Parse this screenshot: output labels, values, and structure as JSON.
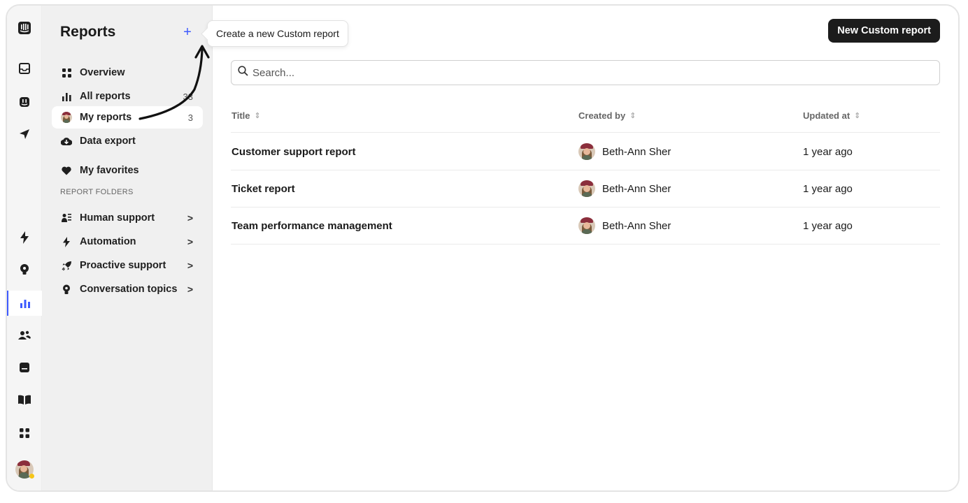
{
  "sidebar": {
    "title": "Reports",
    "add_icon": "plus-icon",
    "items": [
      {
        "label": "Overview",
        "icon": "grid-icon"
      },
      {
        "label": "All reports",
        "icon": "bar-chart-icon",
        "count": "33"
      },
      {
        "label": "My reports",
        "icon": "avatar-icon",
        "count": "3"
      },
      {
        "label": "Data export",
        "icon": "cloud-download-icon"
      },
      {
        "label": "My favorites",
        "icon": "heart-icon"
      }
    ],
    "section_label": "REPORT FOLDERS",
    "folders": [
      {
        "label": "Human support",
        "icon": "human-support-icon"
      },
      {
        "label": "Automation",
        "icon": "lightning-icon"
      },
      {
        "label": "Proactive support",
        "icon": "rocket-icon"
      },
      {
        "label": "Conversation topics",
        "icon": "lightbulb-icon"
      }
    ],
    "chevron": ">"
  },
  "tooltip": {
    "text": "Create a new Custom report"
  },
  "main": {
    "new_button_label": "New Custom report",
    "search_placeholder": "Search...",
    "columns": [
      "Title",
      "Created by",
      "Updated at"
    ],
    "sort_glyph": "⇕",
    "rows": [
      {
        "title": "Customer support report",
        "created_by": "Beth-Ann Sher",
        "updated_at": "1 year ago"
      },
      {
        "title": "Ticket report",
        "created_by": "Beth-Ann Sher",
        "updated_at": "1 year ago"
      },
      {
        "title": "Team performance management",
        "created_by": "Beth-Ann Sher",
        "updated_at": "1 year ago"
      }
    ]
  },
  "colors": {
    "accent": "#3d5afe",
    "button_bg": "#1c1c1c",
    "sidebar_bg": "#f0f0f0"
  }
}
